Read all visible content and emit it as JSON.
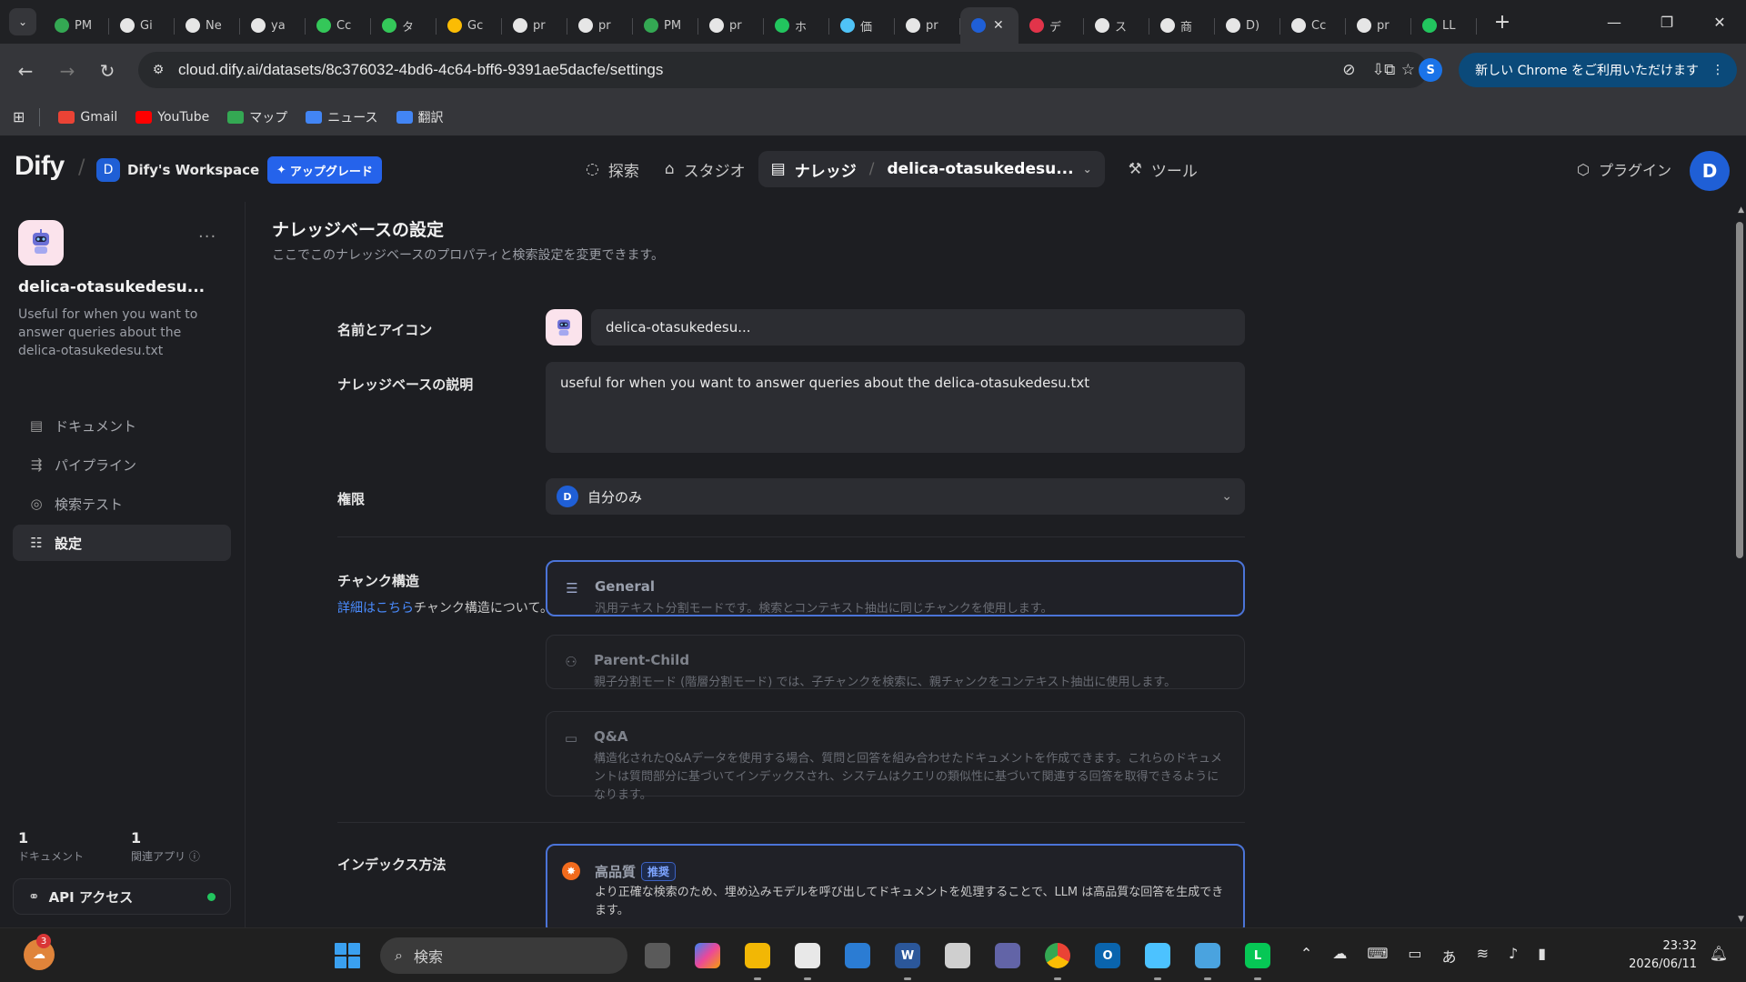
{
  "browser": {
    "tabs": [
      {
        "label": "PM",
        "icon": "sheets-icon",
        "color": "#34a853"
      },
      {
        "label": "Gi",
        "icon": "github-icon",
        "color": "#e6e6e6"
      },
      {
        "label": "Ne",
        "icon": "github-icon",
        "color": "#e6e6e6"
      },
      {
        "label": "ya",
        "icon": "x-icon",
        "color": "#e6e6e6"
      },
      {
        "label": "Cc",
        "icon": "chatgpt-icon",
        "color": "#34c759"
      },
      {
        "label": "タ",
        "icon": "chatgpt-icon",
        "color": "#34c759"
      },
      {
        "label": "Gc",
        "icon": "meet-icon",
        "color": "#fbbc04"
      },
      {
        "label": "pr",
        "icon": "github-icon",
        "color": "#e6e6e6"
      },
      {
        "label": "pr",
        "icon": "github-icon",
        "color": "#e6e6e6"
      },
      {
        "label": "PM",
        "icon": "sheets-icon",
        "color": "#34a853"
      },
      {
        "label": "pr",
        "icon": "github-icon",
        "color": "#e6e6e6"
      },
      {
        "label": "ホ",
        "icon": "leaf-icon",
        "color": "#22c55e"
      },
      {
        "label": "価",
        "icon": "chart-icon",
        "color": "#4fc3f7"
      },
      {
        "label": "pr",
        "icon": "github-icon",
        "color": "#e6e6e6"
      },
      {
        "label": "",
        "icon": "dify-icon",
        "color": "#1f5fd6",
        "active": true
      },
      {
        "label": "デ",
        "icon": "red-circle-icon",
        "color": "#e2344a"
      },
      {
        "label": "ス",
        "icon": "openai-icon",
        "color": "#e6e6e6"
      },
      {
        "label": "商",
        "icon": "notion-icon",
        "color": "#e6e6e6"
      },
      {
        "label": "D)",
        "icon": "notion-icon",
        "color": "#e6e6e6"
      },
      {
        "label": "Cc",
        "icon": "cursor-icon",
        "color": "#e6e6e6"
      },
      {
        "label": "pr",
        "icon": "github-icon",
        "color": "#e6e6e6"
      },
      {
        "label": "LL",
        "icon": "code-icon",
        "color": "#22c55e"
      }
    ],
    "url": "cloud.dify.ai/datasets/8c376032-4bd6-4c64-bff6-9391ae5dacfe/settings",
    "profile_initial": "S",
    "chrome_notice": "新しい Chrome をご利用いただけます",
    "bookmarks": [
      {
        "label": "Gmail",
        "color": "#ea4335"
      },
      {
        "label": "YouTube",
        "color": "#ff0000"
      },
      {
        "label": "マップ",
        "color": "#34a853"
      },
      {
        "label": "ニュース",
        "color": "#4285f4"
      },
      {
        "label": "翻訳",
        "color": "#4285f4"
      }
    ]
  },
  "header": {
    "logo": "Dify",
    "workspace_initial": "D",
    "workspace_name": "Dify's Workspace",
    "upgrade_label": "アップグレード",
    "nav": {
      "explore": "探索",
      "studio": "スタジオ",
      "knowledge": "ナレッジ",
      "dataset": "delica-otasukedesu...",
      "tools": "ツール"
    },
    "plugins": "プラグイン",
    "avatar_initial": "D"
  },
  "sidebar": {
    "name": "delica-otasukedesu...",
    "description": "Useful for when you want to answer queries about the delica-otasukedesu.txt",
    "items": [
      {
        "label": "ドキュメント",
        "icon": "document-icon"
      },
      {
        "label": "パイプライン",
        "icon": "pipeline-icon"
      },
      {
        "label": "検索テスト",
        "icon": "target-icon"
      },
      {
        "label": "設定",
        "icon": "settings-icon",
        "active": true
      }
    ],
    "stats": [
      {
        "value": "1",
        "label": "ドキュメント"
      },
      {
        "value": "1",
        "label": "関連アプリ ⓘ"
      }
    ],
    "api_label": "API アクセス",
    "api_status_color": "#22c55e"
  },
  "main": {
    "title": "ナレッジベースの設定",
    "subtitle": "ここでこのナレッジベースのプロパティと検索設定を変更できます。",
    "name_label": "名前とアイコン",
    "name_value": "delica-otasukedesu...",
    "desc_label": "ナレッジベースの説明",
    "desc_value": "useful for when you want to answer queries about the delica-otasukedesu.txt",
    "perm_label": "権限",
    "perm_initial": "D",
    "perm_value": "自分のみ",
    "chunk_label": "チャンク構造",
    "chunk_help_link": "詳細はこちら",
    "chunk_help_rest": "チャンク構造について。",
    "chunk_options": [
      {
        "title": "General",
        "desc": "汎用テキスト分割モードです。検索とコンテキスト抽出に同じチャンクを使用します。",
        "selected": true
      },
      {
        "title": "Parent-Child",
        "desc": "親子分割モード (階層分割モード) では、子チャンクを検索に、親チャンクをコンテキスト抽出に使用します。",
        "selected": false
      },
      {
        "title": "Q&A",
        "desc": "構造化されたQ&Aデータを使用する場合、質問と回答を組み合わせたドキュメントを作成できます。これらのドキュメントは質問部分に基づいてインデックスされ、システムはクエリの類似性に基づいて関連する回答を取得できるようになります。",
        "selected": false
      }
    ],
    "index_label": "インデックス方法",
    "index_title": "高品質",
    "index_badge": "推奨",
    "index_desc": "より正確な検索のため、埋め込みモデルを呼び出してドキュメントを処理することで、LLM は高品質な回答を生成できます。"
  },
  "taskbar": {
    "weather_badge": "3",
    "search_placeholder": "検索",
    "time": "23:32",
    "date": "2026/06/11"
  }
}
